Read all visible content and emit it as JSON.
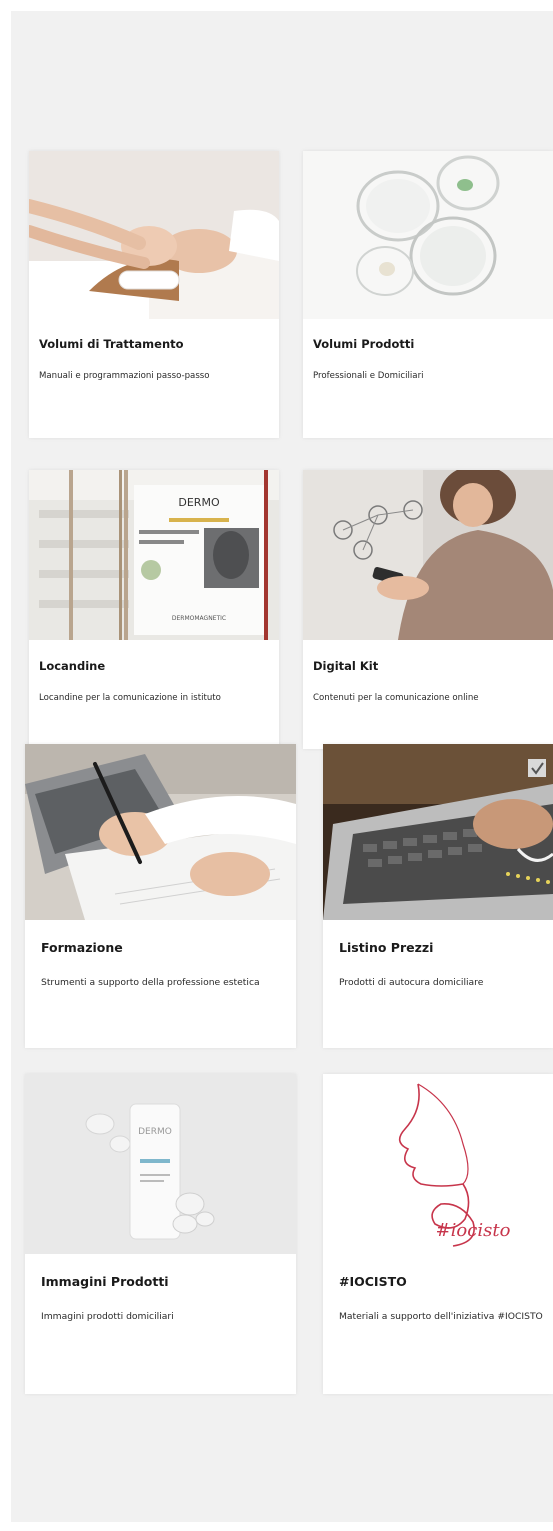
{
  "cards": [
    {
      "title": "Volumi di Trattamento",
      "description": "Manuali e programmazioni passo-passo",
      "image_icon": "facial-massage-photo"
    },
    {
      "title": "Volumi Prodotti",
      "description": "Professionali e Domiciliari",
      "image_icon": "glass-petri-dishes-photo"
    },
    {
      "title": "Locandine",
      "description": "Locandine per la comunicazione in istituto",
      "image_icon": "poster-photo",
      "image_text": {
        "brand": "DERMO",
        "headline": "DERMOMAGNETIC"
      }
    },
    {
      "title": "Digital Kit",
      "description": "Contenuti per la comunicazione online",
      "image_icon": "woman-smartphone-photo"
    },
    {
      "title": "Formazione",
      "description": "Strumenti a supporto della professione estetica",
      "image_icon": "hand-writing-photo"
    },
    {
      "title": "Listino Prezzi",
      "description": "Prodotti di autocura domiciliare",
      "image_icon": "laptop-typing-photo"
    },
    {
      "title": "Immagini Prodotti",
      "description": "Immagini prodotti domiciliari",
      "image_icon": "product-tube-photo",
      "image_text": {
        "brand": "DERMO"
      }
    },
    {
      "title": "#IOCISTO",
      "description": "Materiali a supporto dell'iniziativa #IOCISTO",
      "image_icon": "iocisto-logo",
      "image_text": {
        "logo": "#iocisto"
      }
    }
  ],
  "colors": {
    "panel_background": "#f1f1f1",
    "card_background": "#ffffff",
    "iocisto_red": "#c7354b"
  }
}
